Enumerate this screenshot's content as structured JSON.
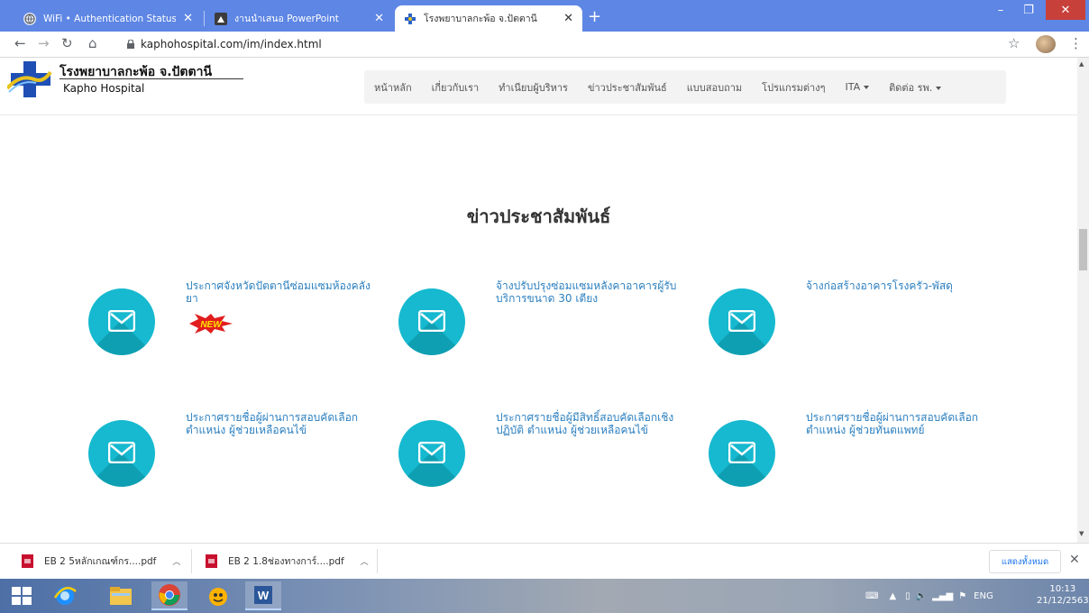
{
  "browser": {
    "tabs": [
      {
        "title": "WiFi • Authentication Status",
        "active": false,
        "favicon": "globe-icon"
      },
      {
        "title": "งานนำเสนอ PowerPoint",
        "active": false,
        "favicon": "powerpoint-icon"
      },
      {
        "title": "โรงพยาบาลกะพ้อ จ.ปัตตานี",
        "active": true,
        "favicon": "hospital-cross-icon"
      }
    ],
    "new_tab_label": "+",
    "url": "kaphohospital.com/im/index.html"
  },
  "site": {
    "name_th": "โรงพยาบาลกะพ้อ จ.ปัตตานี",
    "name_en": "Kapho  Hospital",
    "nav": [
      {
        "label": "หน้าหลัก",
        "dropdown": false
      },
      {
        "label": "เกี่ยวกับเรา",
        "dropdown": false
      },
      {
        "label": "ทำเนียบผู้บริหาร",
        "dropdown": false
      },
      {
        "label": "ข่าวประชาสัมพันธ์",
        "dropdown": false
      },
      {
        "label": "แบบสอบถาม",
        "dropdown": false
      },
      {
        "label": "โปรแกรมต่างๆ",
        "dropdown": false
      },
      {
        "label": "ITA",
        "dropdown": true
      },
      {
        "label": "ติดต่อ รพ.",
        "dropdown": true
      }
    ],
    "section_title": "ข่าวประชาสัมพันธ์",
    "news": [
      {
        "title": "ประกาศจังหวัดปัตตานีซ่อมแซมห้องคลังยา",
        "badge": "NEW"
      },
      {
        "title": "จ้างปรับปรุงซ่อมแซมหลังคาอาคารผู้รับบริการขนาด 30 เตียง"
      },
      {
        "title": "จ้างก่อสร้างอาคารโรงครัว-พัสดุ"
      },
      {
        "title": "ประกาศรายชื่อผู้ผ่านการสอบคัดเลือก ตำแหน่ง ผู้ช่วยเหลือคนไข้"
      },
      {
        "title": "ประกาศรายชื่อผู้มีสิทธิ์สอบคัดเลือกเชิงปฏิบัติ ตำแหน่ง ผู้ช่วยเหลือคนไข้"
      },
      {
        "title": "ประกาศรายชื่อผู้ผ่านการสอบคัดเลือก ตำแหน่ง ผู้ช่วยทันตแพทย์"
      }
    ]
  },
  "downloads": {
    "items": [
      {
        "name": "EB 2 5หลักเกณฑ์กร....pdf"
      },
      {
        "name": "EB 2 1.8ช่องทางการ์....pdf"
      }
    ],
    "show_all_label": "แสดงทั้งหมด"
  },
  "taskbar": {
    "language": "ENG",
    "time": "10:13",
    "date": "21/12/2563"
  },
  "colors": {
    "accent_tab": "#5e86e4",
    "news_circle": "#16b9cf",
    "link": "#2b7fbf"
  }
}
